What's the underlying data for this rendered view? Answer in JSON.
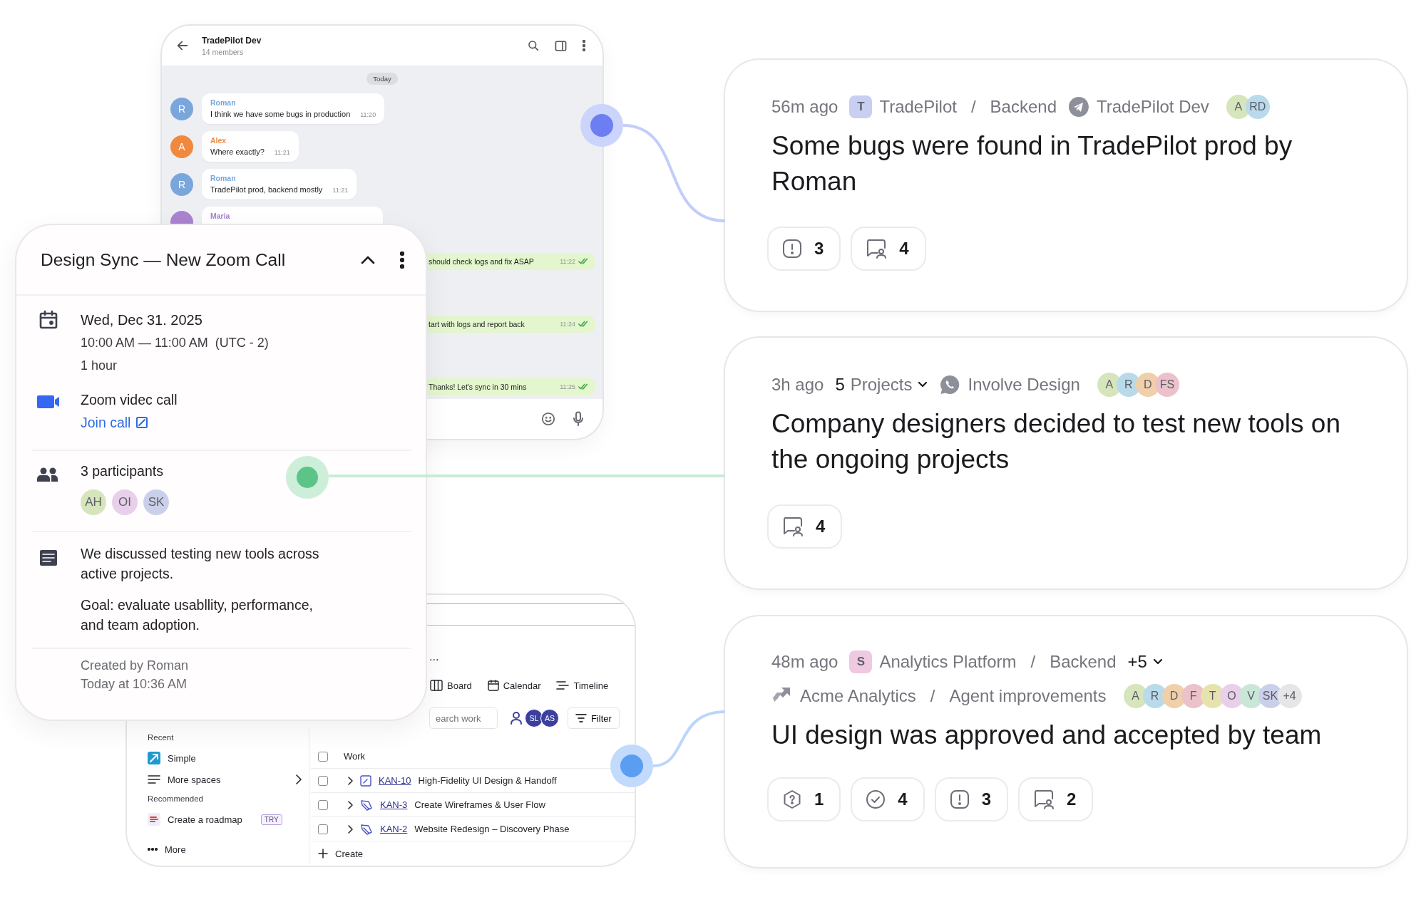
{
  "chat": {
    "title": "TradePilot Dev",
    "subtitle": "14 members",
    "date_chip": "Today",
    "messages": [
      {
        "kind": "incoming",
        "avatar": "R",
        "color": "#7aa6dc",
        "author": "Roman",
        "text": "I think we have some bugs in production",
        "time": "11:20"
      },
      {
        "kind": "incoming",
        "avatar": "A",
        "color": "#f0883e",
        "author": "Alex",
        "text": "Where exactly?",
        "time": "11:21"
      },
      {
        "kind": "incoming",
        "avatar": "R",
        "color": "#7aa6dc",
        "author": "Roman",
        "text": "TradePilot prod, backend mostly",
        "time": "11:21"
      },
      {
        "kind": "incoming",
        "color": "#a983cf",
        "author": "Maria"
      },
      {
        "kind": "outgoing",
        "text": "should check logs and fix ASAP",
        "time": "11:22",
        "read": true
      },
      {
        "kind": "outgoing",
        "text": "tart with logs and report back",
        "time": "11:24",
        "read": true
      },
      {
        "kind": "outgoing",
        "text": "Thanks! Let's sync in 30 mins",
        "time": "11:25",
        "read": true
      }
    ]
  },
  "event": {
    "title": "Design Sync — New Zoom Call",
    "expanded": true,
    "date": "Wed, Dec 31. 2025",
    "time": "10:00 AM — 11:00 AM  (UTC - 2)",
    "duration": "1 hour",
    "call": "Zoom videc call",
    "join": "Join call",
    "participants_label": "3 participants",
    "participants": [
      {
        "initials": "AH",
        "color": "#d6e5bb"
      },
      {
        "initials": "OI",
        "color": "#e8cfea"
      },
      {
        "initials": "SK",
        "color": "#cbd0ea"
      }
    ],
    "notes": [
      "We discussed testing new tools across active projects.",
      "Goal: evaluate usabllity, performance, and team adoption."
    ],
    "created_by": "Created by Roman",
    "created_at": "Today at 10:36 AM"
  },
  "jira": {
    "overflow": "...",
    "views": [
      {
        "kind": "board",
        "label": "Board"
      },
      {
        "kind": "calendar",
        "label": "Calendar"
      },
      {
        "kind": "timeline",
        "label": "Timeline"
      }
    ],
    "search": {
      "placeholder": "earch work"
    },
    "assignees": [
      "SL",
      "AS"
    ],
    "filter": "Filter",
    "sidebar": [
      {
        "kind": "heading",
        "label": "Recent"
      },
      {
        "kind": "space",
        "label": "Simple"
      },
      {
        "kind": "list",
        "label": "More spaces"
      },
      {
        "kind": "heading",
        "label": "Recommended"
      },
      {
        "kind": "roadmap",
        "label": "Create a roadmap",
        "badge": "TRY"
      },
      {
        "kind": "more",
        "label": "More"
      }
    ],
    "table": {
      "column": "Work",
      "all_checked": false,
      "rows": [
        {
          "kind": "task",
          "key": "KAN-10",
          "title": "High-Fidelity UI Design & Handoff",
          "checked": false
        },
        {
          "kind": "epic",
          "key": "KAN-3",
          "title": "Create Wireframes & User Flow",
          "checked": false
        },
        {
          "kind": "epic",
          "key": "KAN-2",
          "title": "Website Redesign – Discovery Phase",
          "checked": false
        }
      ],
      "create": "Create"
    }
  },
  "feed": [
    {
      "meta": [
        [
          {
            "kind": "time",
            "label": "56m ago"
          },
          {
            "kind": "space",
            "badge": "T",
            "color": "#c9cff0",
            "label": "TradePilot"
          },
          {
            "kind": "separator",
            "label": "/"
          },
          {
            "kind": "text",
            "label": "Backend"
          },
          {
            "kind": "plane",
            "label": "TradePilot Dev"
          },
          {
            "kind": "avatars",
            "items": [
              {
                "initials": "A",
                "color": "#d6e5bb"
              },
              {
                "initials": "RD",
                "color": "#b9daea"
              }
            ]
          }
        ]
      ],
      "title": "Some bugs were found in TradePilot prod by Roman",
      "stats": [
        {
          "kind": "issue",
          "value": "3"
        },
        {
          "kind": "comment",
          "value": "4"
        }
      ]
    },
    {
      "meta": [
        [
          {
            "kind": "time",
            "label": "3h ago"
          },
          {
            "kind": "dropdown",
            "count": "5",
            "label": "Projects"
          },
          {
            "kind": "phone",
            "label": "Involve Design"
          },
          {
            "kind": "avatars",
            "items": [
              {
                "initials": "A",
                "color": "#d6e5bb"
              },
              {
                "initials": "R",
                "color": "#b9daea"
              },
              {
                "initials": "D",
                "color": "#f0d0aa"
              },
              {
                "initials": "FS",
                "color": "#ebc2ca"
              }
            ]
          }
        ]
      ],
      "title": "Company designers decided to test new tools on the ongoing projects",
      "stats": [
        {
          "kind": "comment",
          "value": "4"
        }
      ]
    },
    {
      "meta": [
        [
          {
            "kind": "time",
            "label": "48m ago"
          },
          {
            "kind": "space",
            "badge": "S",
            "color": "#efc9e0",
            "label": "Analytics Platform"
          },
          {
            "kind": "separator",
            "label": "/"
          },
          {
            "kind": "text",
            "label": "Backend"
          },
          {
            "kind": "dropdown",
            "count": "+5"
          }
        ],
        [
          {
            "kind": "tracker",
            "label": "Acme Analytics"
          },
          {
            "kind": "separator",
            "label": "/"
          },
          {
            "kind": "text",
            "label": "Agent improvements"
          },
          {
            "kind": "avatars",
            "items": [
              {
                "initials": "A",
                "color": "#d6e5bb"
              },
              {
                "initials": "R",
                "color": "#b9daea"
              },
              {
                "initials": "D",
                "color": "#f0d0aa"
              },
              {
                "initials": "F",
                "color": "#ebc2ca"
              },
              {
                "initials": "T",
                "color": "#e7e3ae"
              },
              {
                "initials": "O",
                "color": "#e8cfea"
              },
              {
                "initials": "V",
                "color": "#c9e7d7"
              },
              {
                "initials": "SK",
                "color": "#cbd0ea"
              },
              {
                "initials": "+4",
                "color": "#e6e6e8"
              }
            ]
          }
        ]
      ],
      "title": "UI design was approved and accepted by team",
      "stats": [
        {
          "kind": "question",
          "value": "1"
        },
        {
          "kind": "done",
          "value": "4"
        },
        {
          "kind": "issue",
          "value": "3"
        },
        {
          "kind": "comment",
          "value": "2"
        }
      ]
    }
  ]
}
